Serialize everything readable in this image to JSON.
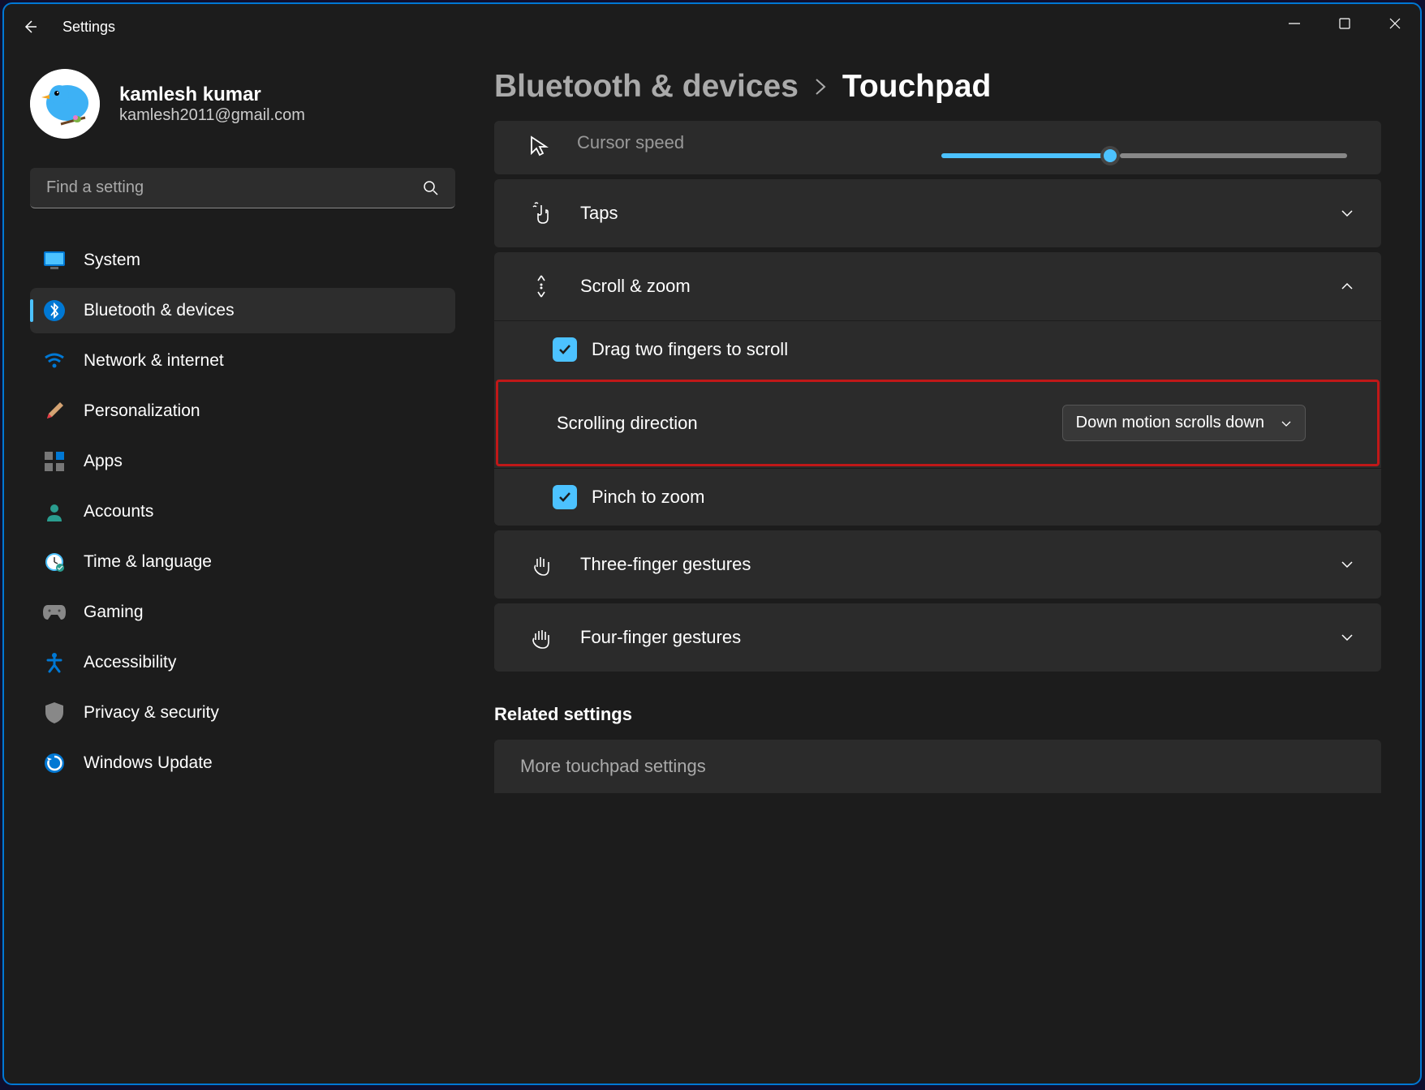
{
  "app": {
    "title": "Settings"
  },
  "profile": {
    "name": "kamlesh kumar",
    "email": "kamlesh2011@gmail.com"
  },
  "search": {
    "placeholder": "Find a setting"
  },
  "nav": {
    "system": "System",
    "bluetooth": "Bluetooth & devices",
    "network": "Network & internet",
    "personalization": "Personalization",
    "apps": "Apps",
    "accounts": "Accounts",
    "time": "Time & language",
    "gaming": "Gaming",
    "accessibility": "Accessibility",
    "privacy": "Privacy & security",
    "update": "Windows Update"
  },
  "breadcrumb": {
    "parent": "Bluetooth & devices",
    "current": "Touchpad"
  },
  "panels": {
    "cursorSpeed": "Cursor speed",
    "taps": "Taps",
    "scrollZoom": "Scroll & zoom",
    "dragTwoFingers": "Drag two fingers to scroll",
    "scrollingDirection": "Scrolling direction",
    "scrollingDirectionValue": "Down motion scrolls down",
    "pinchToZoom": "Pinch to zoom",
    "threeFinger": "Three-finger gestures",
    "fourFinger": "Four-finger gestures"
  },
  "related": {
    "heading": "Related settings",
    "moreTouchpad": "More touchpad settings"
  }
}
